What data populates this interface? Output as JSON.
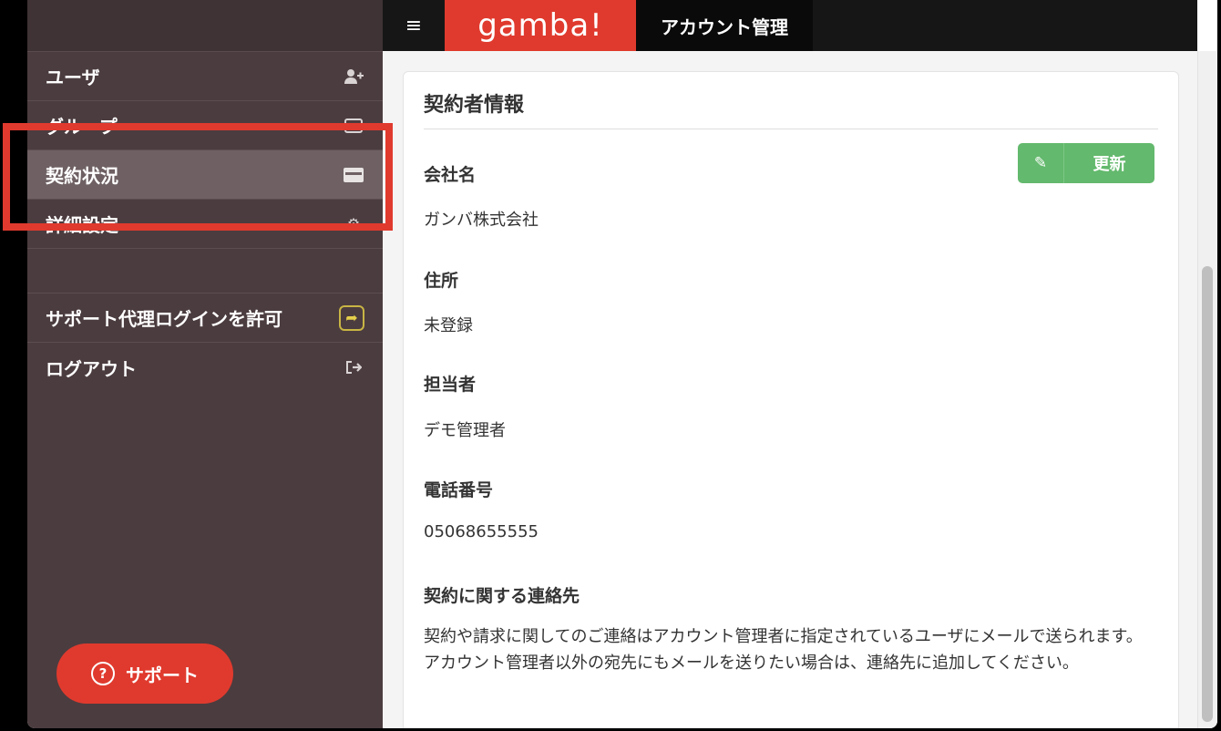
{
  "header": {
    "menu_icon": "hamburger-icon",
    "logo": "gamba!",
    "title": "アカウント管理"
  },
  "sidebar": {
    "items": [
      {
        "label": "ユーザ",
        "icon": "add-user-icon"
      },
      {
        "label": "グループ",
        "icon": "group-icon"
      },
      {
        "label": "契約状況",
        "icon": "credit-card-icon",
        "active": true
      },
      {
        "label": "詳細設定",
        "icon": "gear-icon"
      }
    ],
    "support_login": {
      "label": "サポート代理ログインを許可",
      "icon": "share-icon"
    },
    "logout": {
      "label": "ログアウト",
      "icon": "sign-out-icon"
    },
    "support_button": {
      "label": "サポート",
      "icon": "question-icon"
    }
  },
  "main": {
    "section_title": "契約者情報",
    "update_button": {
      "label": "更新",
      "icon": "edit-icon"
    },
    "fields": [
      {
        "label": "会社名",
        "value": "ガンバ株式会社"
      },
      {
        "label": "住所",
        "value": "未登録"
      },
      {
        "label": "担当者",
        "value": "デモ管理者"
      },
      {
        "label": "電話番号",
        "value": "05068655555"
      }
    ],
    "contact": {
      "label": "契約に関する連絡先",
      "description": "契約や請求に関してのご連絡はアカウント管理者に指定されているユーザにメールで送られます。アカウント管理者以外の宛先にもメールを送りたい場合は、連絡先に追加してください。"
    }
  },
  "colors": {
    "accent": "#e03a2e",
    "sidebar": "#4b3c3f",
    "active_item": "#6e6063",
    "update_button": "#63b96d"
  }
}
